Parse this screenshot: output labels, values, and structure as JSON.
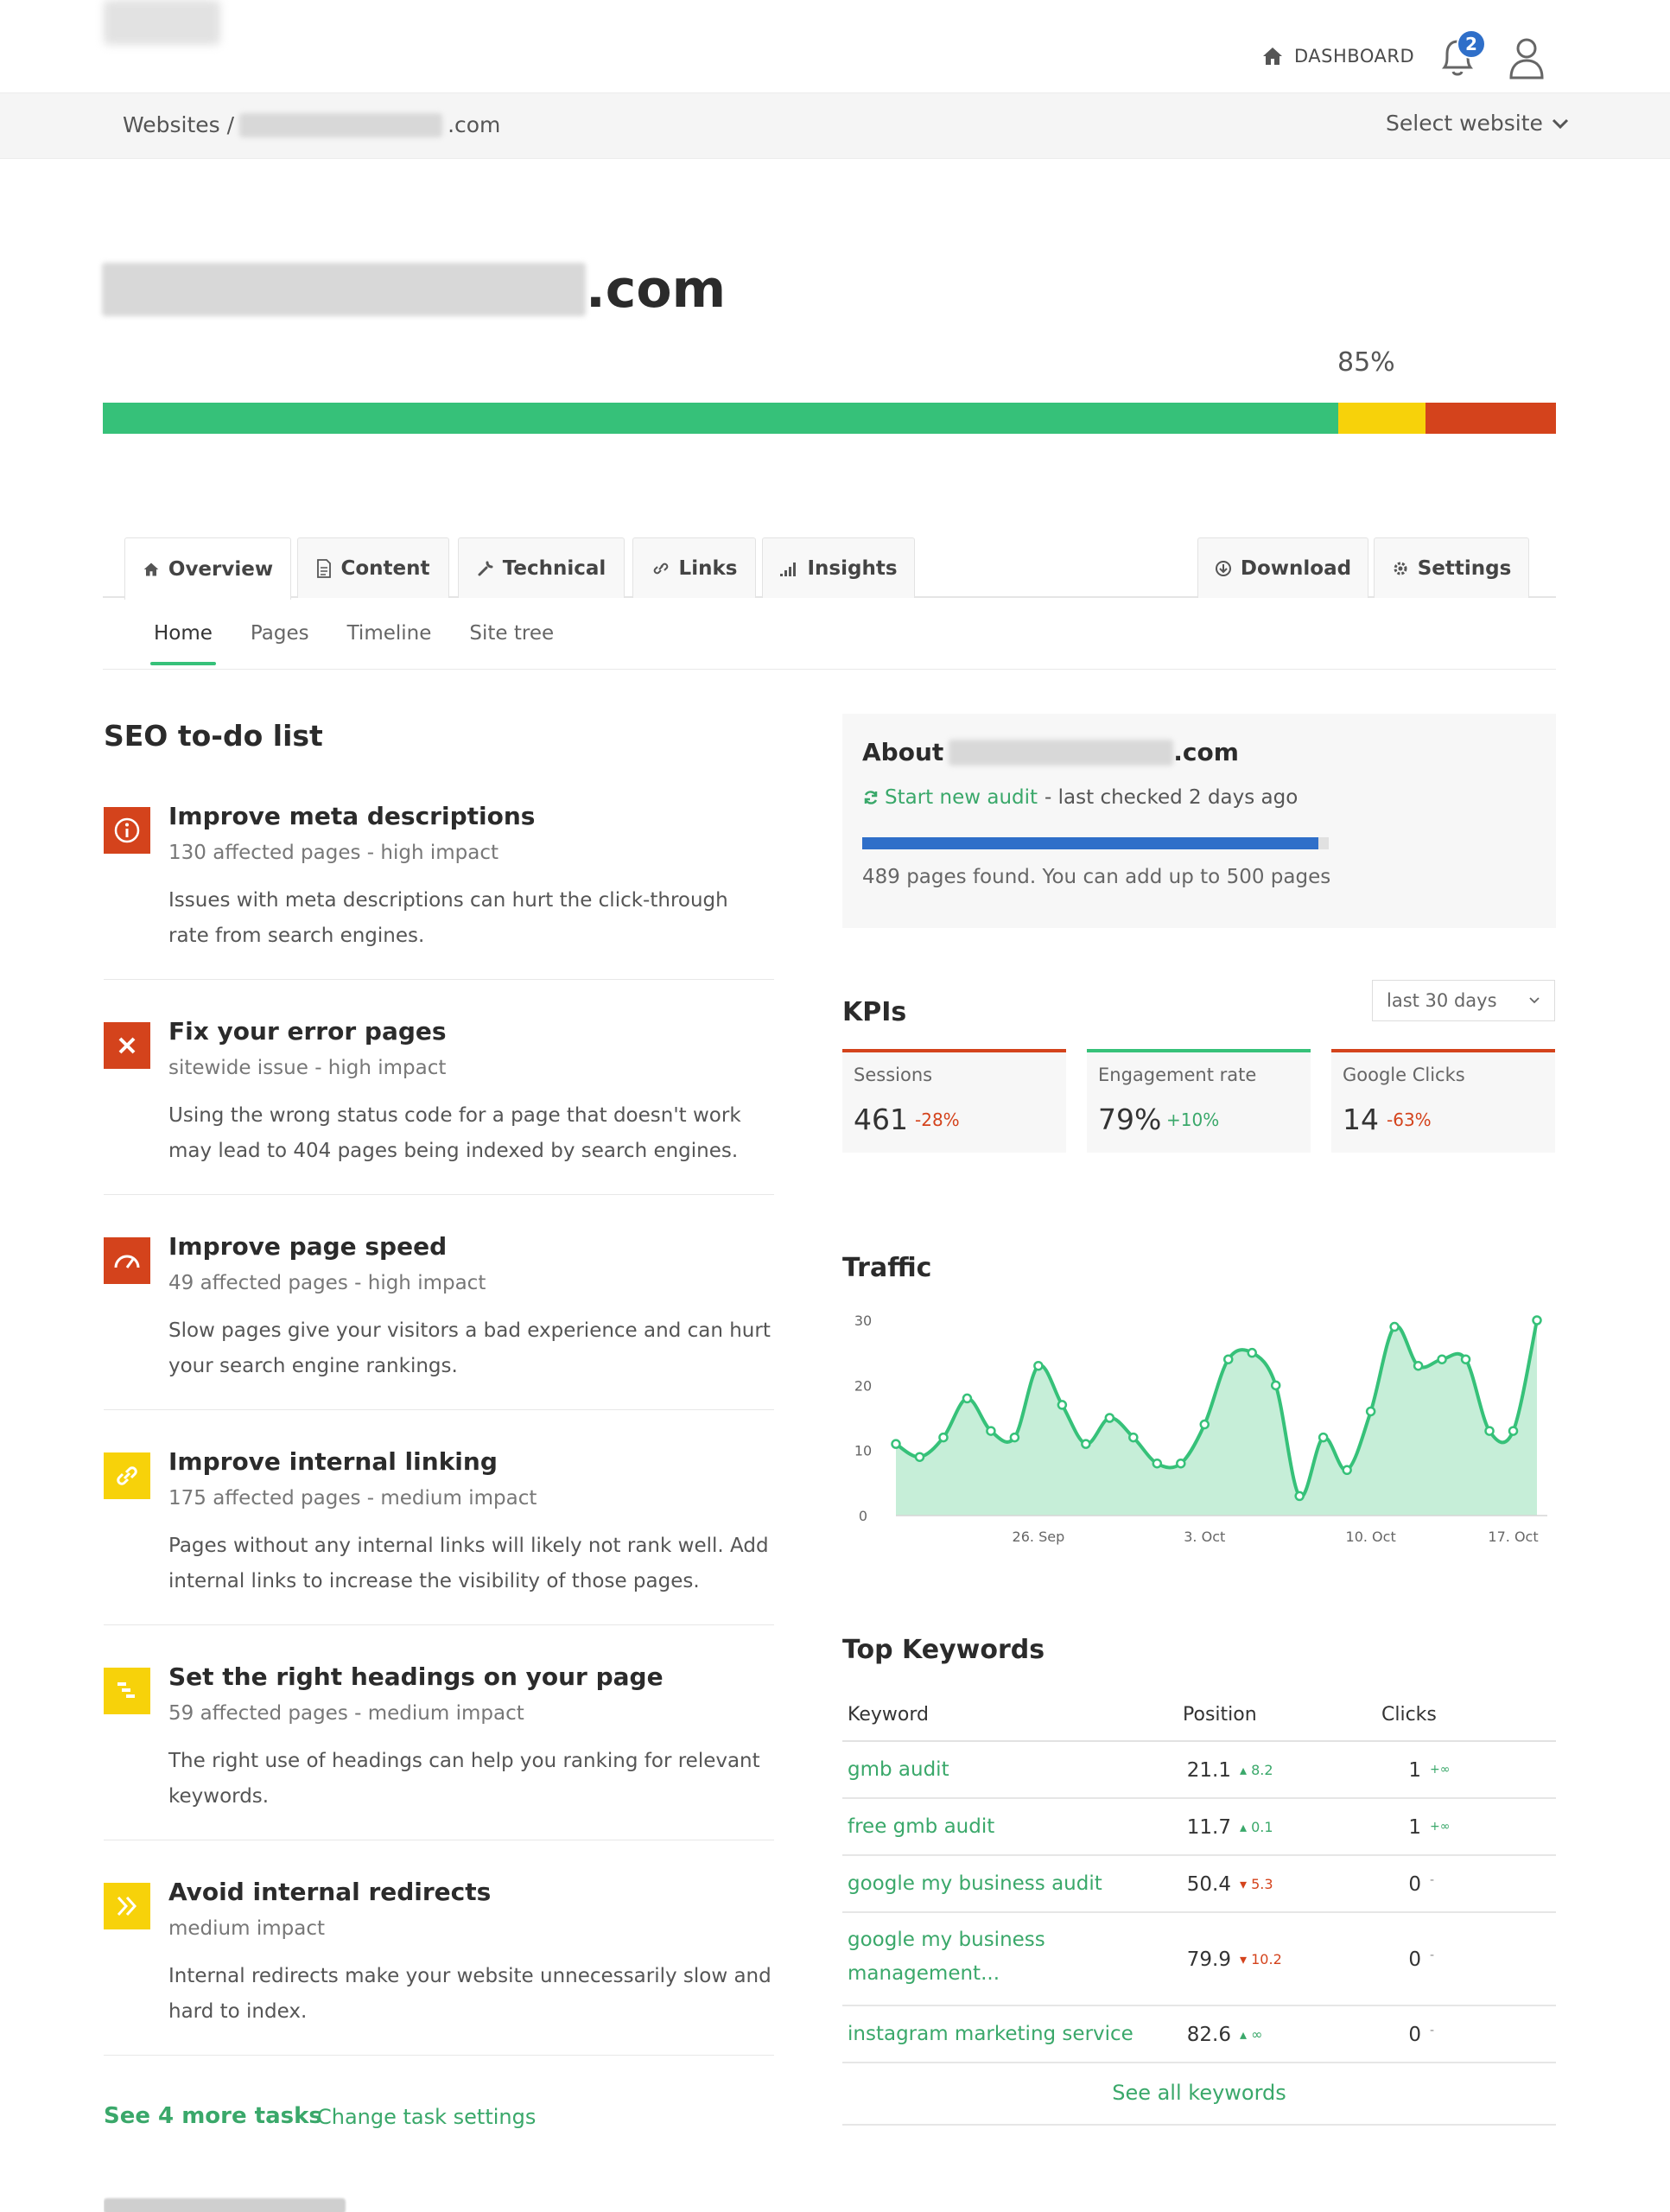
{
  "header": {
    "dashboard_label": "DASHBOARD",
    "notifications_count": "2"
  },
  "breadcrumb": {
    "root": "Websites /",
    "domain_suffix": ".com",
    "select_label": "Select website"
  },
  "site": {
    "title_suffix": ".com",
    "score": "85%",
    "score_segments": {
      "good": 85,
      "warning": 6,
      "error": 9
    }
  },
  "tabs": [
    {
      "label": "Overview",
      "icon": "home-icon"
    },
    {
      "label": "Content",
      "icon": "document-icon"
    },
    {
      "label": "Technical",
      "icon": "wrench-icon"
    },
    {
      "label": "Links",
      "icon": "link-icon"
    },
    {
      "label": "Insights",
      "icon": "signal-icon"
    }
  ],
  "actions": [
    {
      "label": "Download",
      "icon": "download-icon"
    },
    {
      "label": "Settings",
      "icon": "gear-icon"
    }
  ],
  "subnav": [
    "Home",
    "Pages",
    "Timeline",
    "Site tree"
  ],
  "todo": {
    "title": "SEO to-do list",
    "tasks": [
      {
        "title": "Improve meta descriptions",
        "sub": "130 affected pages - high impact",
        "desc": "Issues with meta descriptions can hurt the click-through rate from search engines.",
        "icon": "info-icon",
        "color": "#d4431c"
      },
      {
        "title": "Fix your error pages",
        "sub": "sitewide issue - high impact",
        "desc": "Using the wrong status code for a page that doesn't work may lead to 404 pages being indexed by search engines.",
        "icon": "x-icon",
        "color": "#d4431c"
      },
      {
        "title": "Improve page speed",
        "sub": "49 affected pages - high impact",
        "desc": "Slow pages give your visitors a bad experience and can hurt your search engine rankings.",
        "icon": "speedometer-icon",
        "color": "#d4431c"
      },
      {
        "title": "Improve internal linking",
        "sub": "175 affected pages - medium impact",
        "desc": "Pages without any internal links will likely not rank well. Add internal links to increase the visibility of those pages.",
        "icon": "link-icon",
        "color": "#f7d20a"
      },
      {
        "title": "Set the right headings on your page",
        "sub": "59 affected pages - medium impact",
        "desc": "The right use of headings can help you ranking for relevant keywords.",
        "icon": "headings-icon",
        "color": "#f7d20a"
      },
      {
        "title": "Avoid internal redirects",
        "sub": "medium impact",
        "desc": "Internal redirects make your website unnecessarily slow and hard to index.",
        "icon": "double-chevron-icon",
        "color": "#f7d20a"
      }
    ],
    "see_more": "See 4 more tasks",
    "change_settings": "Change task settings"
  },
  "about": {
    "prefix": "About",
    "suffix": ".com",
    "audit_link": "Start new audit",
    "last_checked": "- last checked 2 days ago",
    "pages_found_text": "489 pages found. You can add up to 500 pages",
    "pages_fraction": 0.978
  },
  "kpis": {
    "title": "KPIs",
    "range": "last 30 days",
    "items": [
      {
        "label": "Sessions",
        "value": "461",
        "change": "-28%",
        "trend": "down"
      },
      {
        "label": "Engagement rate",
        "value": "79%",
        "change": "+10%",
        "trend": "up"
      },
      {
        "label": "Google Clicks",
        "value": "14",
        "change": "-63%",
        "trend": "down"
      }
    ]
  },
  "traffic": {
    "title": "Traffic"
  },
  "chart_data": {
    "type": "area",
    "title": "Traffic",
    "xlabel": "",
    "ylabel": "",
    "ylim": [
      0,
      30
    ],
    "yticks": [
      "0",
      "10",
      "20",
      "30"
    ],
    "xtick_labels": [
      {
        "label": "26. Sep",
        "index": 6
      },
      {
        "label": "3. Oct",
        "index": 13
      },
      {
        "label": "10. Oct",
        "index": 20
      },
      {
        "label": "17. Oct",
        "index": 26
      }
    ],
    "values": [
      11,
      9,
      12,
      18,
      13,
      12,
      23,
      17,
      11,
      15,
      12,
      8,
      8,
      14,
      24,
      25,
      20,
      3,
      12,
      7,
      16,
      29,
      23,
      24,
      24,
      13,
      13,
      30
    ],
    "color": "#36c179",
    "fill": "#c6eed8",
    "grid": false
  },
  "keywords": {
    "title": "Top Keywords",
    "headers": {
      "keyword": "Keyword",
      "position": "Position",
      "clicks": "Clicks"
    },
    "rows": [
      {
        "keyword": "gmb audit",
        "position": "21.1",
        "pos_change": "▴ 8.2",
        "pos_trend": "up",
        "clicks": "1",
        "clicks_change": "+∞"
      },
      {
        "keyword": "free gmb audit",
        "position": "11.7",
        "pos_change": "▴ 0.1",
        "pos_trend": "up",
        "clicks": "1",
        "clicks_change": "+∞"
      },
      {
        "keyword": "google my business audit",
        "position": "50.4",
        "pos_change": "▾ 5.3",
        "pos_trend": "down",
        "clicks": "0",
        "clicks_change": "-"
      },
      {
        "keyword": "google my business management...",
        "position": "79.9",
        "pos_change": "▾ 10.2",
        "pos_trend": "down",
        "clicks": "0",
        "clicks_change": "-"
      },
      {
        "keyword": "instagram marketing service",
        "position": "82.6",
        "pos_change": "▴ ∞",
        "pos_trend": "up",
        "clicks": "0",
        "clicks_change": "-"
      }
    ],
    "see_all": "See all keywords"
  }
}
